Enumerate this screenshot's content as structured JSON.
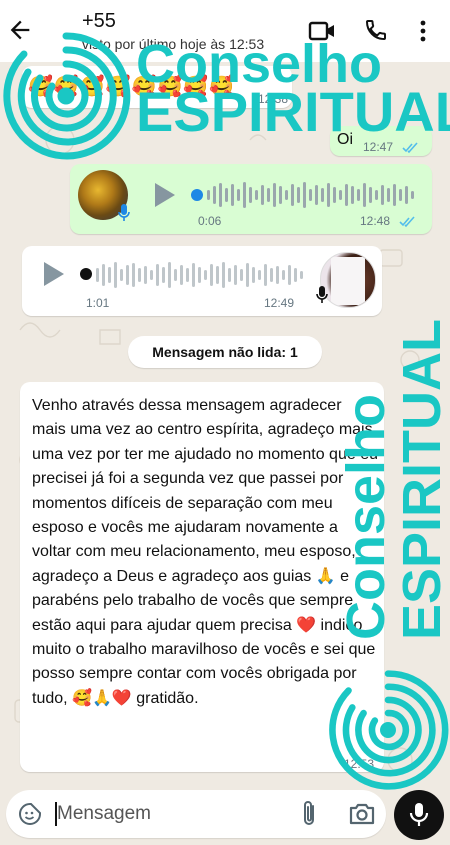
{
  "header": {
    "contact_title": "+55",
    "status": "visto por último hoje às 12:53",
    "back_icon": "arrow-back-icon",
    "video_icon": "video-call-icon",
    "call_icon": "phone-icon",
    "menu_icon": "more-vert-icon"
  },
  "messages": [
    {
      "type": "emoji",
      "direction": "in",
      "text": "🥰🥰🥰🥰🥰🥰🥰🥰",
      "time": "12:38"
    },
    {
      "type": "text",
      "direction": "out",
      "text": "Oi",
      "time": "12:47",
      "status": "read"
    },
    {
      "type": "audio",
      "direction": "out",
      "duration": "0:06",
      "time": "12:48",
      "status": "read"
    },
    {
      "type": "audio",
      "direction": "in",
      "duration": "1:01",
      "time": "12:49"
    }
  ],
  "unread_label": "Mensagem não lida: 1",
  "long_message": {
    "text": "Venho através dessa mensagem agradecer mais uma vez ao centro espírita, agradeço mais uma vez por ter me ajudado no momento que eu precisei já foi a segunda vez que passei por momentos difíceis de separação com meu esposo e vocês me ajudaram novamente a voltar com meu relacionamento, meu esposo, agradeço a Deus e agradeço aos guias 🙏 e parabéns pelo trabalho de vocês que sempre estão aqui para ajudar quem precisa ❤️ indico muito o trabalho maravilhoso de vocês e sei que posso sempre contar com vocês obrigada por tudo, 🥰🙏❤️ gratidão.",
    "time": "12:53"
  },
  "composer": {
    "placeholder": "Mensagem",
    "emoji_icon": "emoji-sticker-icon",
    "attach_icon": "paperclip-icon",
    "camera_icon": "camera-icon",
    "mic_icon": "microphone-icon"
  },
  "watermark": {
    "line1": "Conselho",
    "line2": "ESPIRITUAL",
    "color": "#1ac7c4"
  },
  "colors": {
    "outgoing_bubble": "#d9fdd3",
    "incoming_bubble": "#ffffff",
    "read_ticks": "#53bdeb",
    "chat_background": "#efeae2"
  }
}
